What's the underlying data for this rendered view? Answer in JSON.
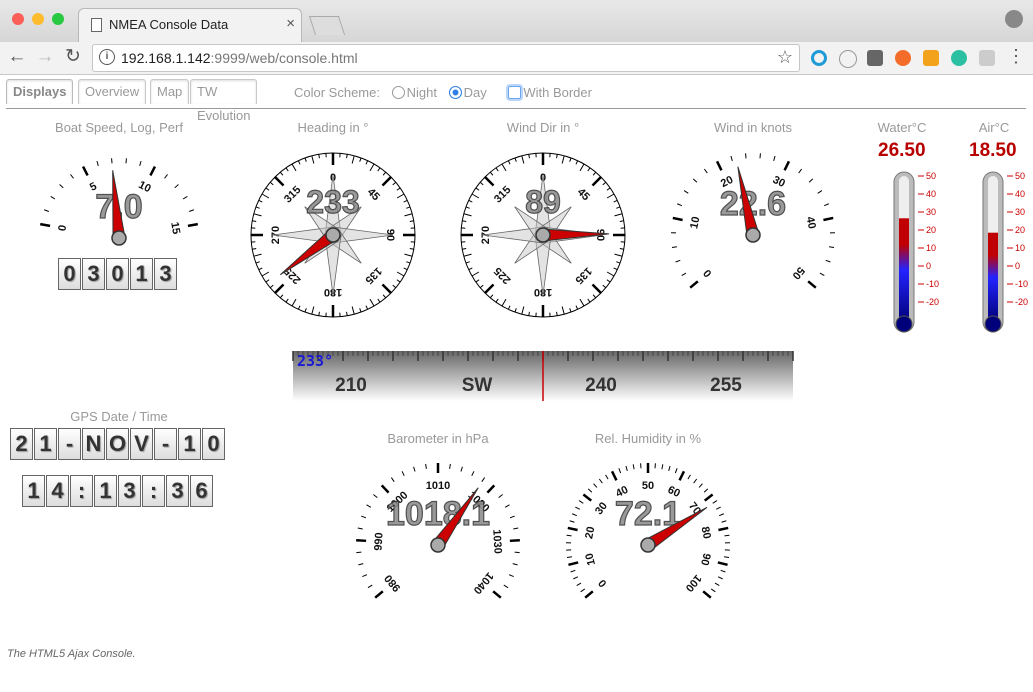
{
  "browser": {
    "tab_title": "NMEA Console Data",
    "url_host": "192.168.1.142",
    "url_rest": ":9999/web/console.html"
  },
  "tabs": [
    {
      "label": "Displays",
      "active": true
    },
    {
      "label": "Overview",
      "active": false
    },
    {
      "label": "Map",
      "active": false
    },
    {
      "label": "TW Evolution",
      "active": false
    }
  ],
  "color_scheme": {
    "label": "Color Scheme:",
    "night_label": "Night",
    "day_label": "Day",
    "selected": "Day",
    "border_label": "With Border",
    "border_checked": false
  },
  "gauges": {
    "boat_speed": {
      "label": "Boat Speed, Log, Perf",
      "value": 7.0,
      "display": "7.0",
      "min": 0,
      "max": 15,
      "ticks": [
        "0",
        "5",
        "10",
        "15"
      ],
      "log": "03013"
    },
    "heading": {
      "label": "Heading in °",
      "value": 233,
      "display": "233",
      "ticks": [
        "0",
        "45",
        "90",
        "135",
        "180",
        "225",
        "270",
        "315"
      ]
    },
    "wind_dir": {
      "label": "Wind Dir in °",
      "value": 89,
      "display": "89",
      "ticks": [
        "0",
        "45",
        "90",
        "135",
        "180",
        "225",
        "270",
        "315"
      ]
    },
    "wind_speed": {
      "label": "Wind in knots",
      "value": 22.6,
      "display": "22.6",
      "min": 0,
      "max": 50,
      "ticks": [
        "0",
        "10",
        "20",
        "30",
        "40",
        "50"
      ]
    },
    "barometer": {
      "label": "Barometer in hPa",
      "value": 1018.1,
      "display": "1018.1",
      "min": 980,
      "max": 1040,
      "ticks": [
        "980",
        "990",
        "1000",
        "1010",
        "1020",
        "1030",
        "1040"
      ]
    },
    "humidity": {
      "label": "Rel. Humidity in %",
      "value": 72.1,
      "display": "72.1",
      "min": 0,
      "max": 100,
      "ticks": [
        "0",
        "10",
        "20",
        "30",
        "40",
        "50",
        "60",
        "70",
        "80",
        "90",
        "100"
      ]
    }
  },
  "thermometers": {
    "water": {
      "label": "Water°C",
      "value": 26.5,
      "display": "26.50",
      "min": -20,
      "max": 50,
      "ticks": [
        "50",
        "40",
        "30",
        "20",
        "10",
        "0",
        "-10",
        "-20"
      ]
    },
    "air": {
      "label": "Air°C",
      "value": 18.5,
      "display": "18.50",
      "min": -20,
      "max": 50,
      "ticks": [
        "50",
        "40",
        "30",
        "20",
        "10",
        "0",
        "-10",
        "-20"
      ]
    }
  },
  "heading_band": {
    "value_label": "233°",
    "marks": [
      "210",
      "SW",
      "240",
      "255"
    ]
  },
  "gps": {
    "label": "GPS Date / Time",
    "date": "21-NOV-10",
    "time": "14:13:36"
  },
  "footer": "The HTML5 Ajax Console.",
  "colors": {
    "needle": "#cc0000",
    "value_red": "#b80000",
    "band_label": "#1a1ad6"
  }
}
